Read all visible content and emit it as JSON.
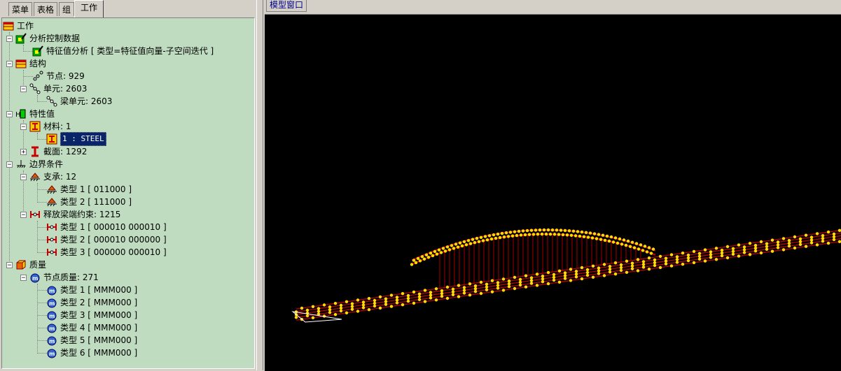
{
  "left_tabs": [
    "菜单",
    "表格",
    "组",
    "工作"
  ],
  "active_tab": "工作",
  "right_tab": "模型窗口",
  "colors": {
    "tree_bg": "#c0dcc0",
    "model_bg": "#000000",
    "node": "#ffdd00",
    "element": "#cc0000",
    "selection": "#0a246a"
  },
  "tree": {
    "root": "工作",
    "analysis": "分析控制数据",
    "eigen": "特征值分析 [ 类型=特征值向量-子空间迭代 ]",
    "structure": "结构",
    "nodes": "节点: 929",
    "elements": "单元: 2603",
    "beam_elements": "梁单元: 2603",
    "properties": "特性值",
    "materials": "材料: 1",
    "material_1": "1 : STEEL",
    "sections": "截面: 1292",
    "boundary": "边界条件",
    "supports": "支承: 12",
    "support_1": "类型 1 [ 011000 ]",
    "support_2": "类型 2 [ 111000 ]",
    "releases": "释放梁端约束: 1215",
    "release_1": "类型 1 [ 000010 000010 ]",
    "release_2": "类型 2 [ 000010 000000 ]",
    "release_3": "类型 3 [ 000000 000010 ]",
    "mass": "质量",
    "nodal_mass": "节点质量: 271",
    "mass_1": "类型 1 [ MMM000 ]",
    "mass_2": "类型 2 [ MMM000 ]",
    "mass_3": "类型 3 [ MMM000 ]",
    "mass_4": "类型 4 [ MMM000 ]",
    "mass_5": "类型 5 [ MMM000 ]",
    "mass_6": "类型 6 [ MMM000 ]"
  }
}
